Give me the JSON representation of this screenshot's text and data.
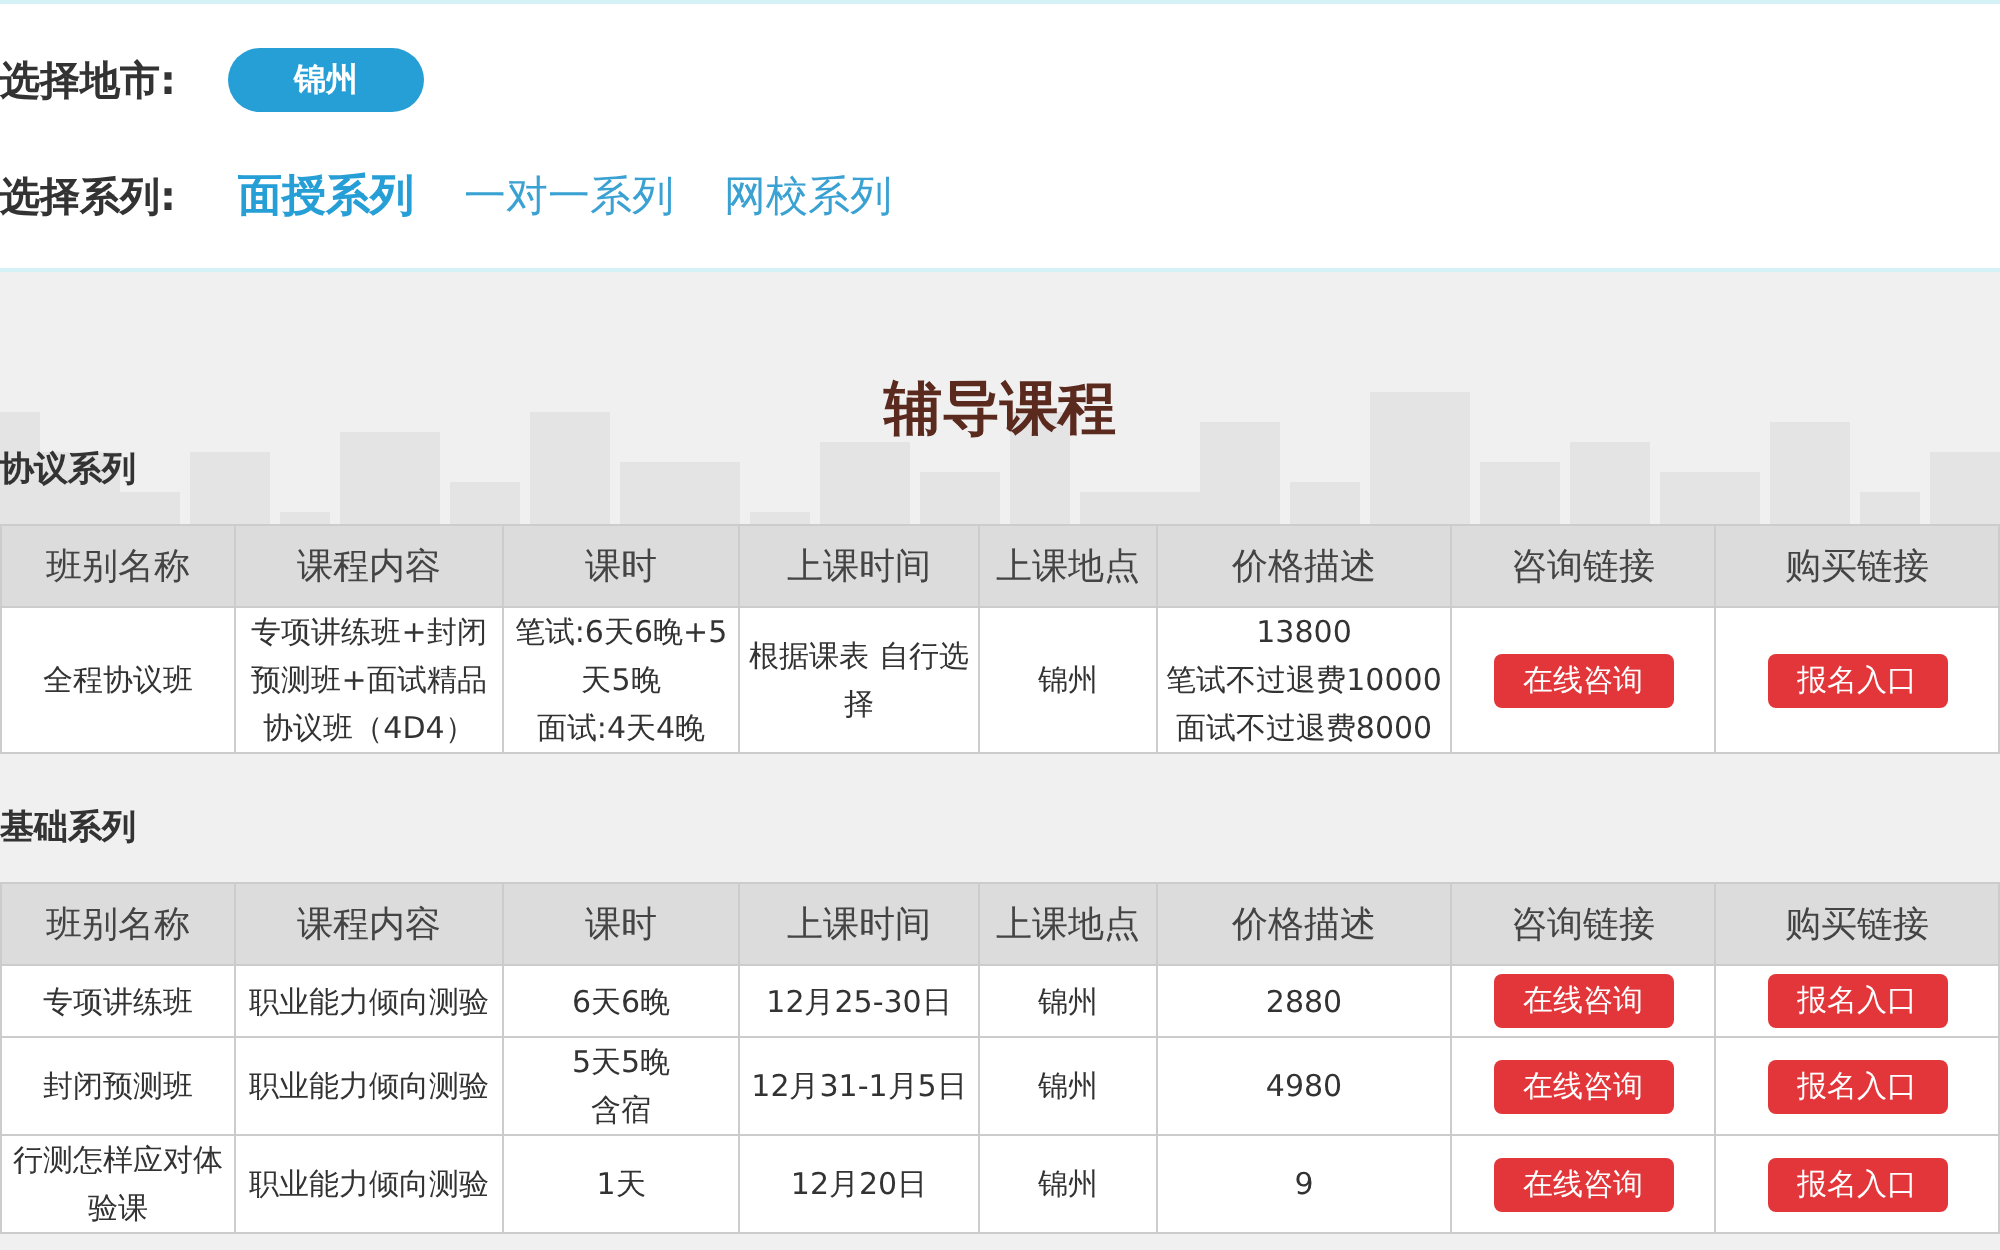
{
  "city_filter": {
    "label": "选择地市:",
    "options": [
      {
        "label": "锦州",
        "selected": true
      }
    ]
  },
  "series_filter": {
    "label": "选择系列:",
    "options": [
      {
        "label": "面授系列",
        "selected": true
      },
      {
        "label": "一对一系列",
        "selected": false
      },
      {
        "label": "网校系列",
        "selected": false
      }
    ]
  },
  "page_title": "辅导课程",
  "sections": [
    {
      "title": "协议系列",
      "columns": [
        "班别名称",
        "课程内容",
        "课时",
        "上课时间",
        "上课地点",
        "价格描述",
        "咨询链接",
        "购买链接"
      ],
      "rows": [
        {
          "cells": [
            "全程协议班",
            "专项讲练班+封闭预测班+面试精品协议班（4D4）",
            [
              "笔试:6天6晚+5天5晚",
              "面试:4天4晚"
            ],
            "根据课表 自行选择",
            "锦州",
            [
              "13800",
              "笔试不过退费10000",
              "面试不过退费8000"
            ]
          ],
          "consult": "在线咨询",
          "buy": "报名入口"
        }
      ]
    },
    {
      "title": "基础系列",
      "columns": [
        "班别名称",
        "课程内容",
        "课时",
        "上课时间",
        "上课地点",
        "价格描述",
        "咨询链接",
        "购买链接"
      ],
      "rows": [
        {
          "cells": [
            "专项讲练班",
            "职业能力倾向测验",
            "6天6晚",
            "12月25-30日",
            "锦州",
            "2880"
          ],
          "consult": "在线咨询",
          "buy": "报名入口"
        },
        {
          "cells": [
            "封闭预测班",
            "职业能力倾向测验",
            [
              "5天5晚",
              "含宿"
            ],
            "12月31-1月5日",
            "锦州",
            "4980"
          ],
          "consult": "在线咨询",
          "buy": "报名入口"
        },
        {
          "cells": [
            "行测怎样应对体验课",
            "职业能力倾向测验",
            "1天",
            "12月20日",
            "锦州",
            "9"
          ],
          "consult": "在线咨询",
          "buy": "报名入口"
        }
      ]
    }
  ]
}
